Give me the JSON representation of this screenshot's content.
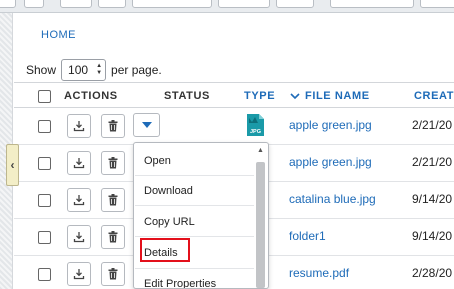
{
  "breadcrumb": "HOME",
  "pagination": {
    "show_label": "Show",
    "per_page_value": "100",
    "per_page_suffix": "per page."
  },
  "table": {
    "headers": {
      "actions": "ACTIONS",
      "status": "STATUS",
      "type": "TYPE",
      "file_name": "FILE NAME",
      "created": "CREATE"
    },
    "sorted_column": "file_name",
    "rows": [
      {
        "name": "apple green.jpg",
        "created": "2/21/20",
        "type": "JPG"
      },
      {
        "name": "apple green.jpg",
        "created": "2/21/20"
      },
      {
        "name": "catalina blue.jpg",
        "created": "9/14/20"
      },
      {
        "name": "folder1",
        "created": "9/14/20"
      },
      {
        "name": "resume.pdf",
        "created": "2/28/20"
      }
    ]
  },
  "menu": {
    "items": [
      "Open",
      "Download",
      "Copy URL",
      "Details",
      "Edit Properties"
    ],
    "highlighted": "Details"
  },
  "colors": {
    "link": "#1e6bb8",
    "highlight": "#e3101b",
    "file_icon": "#1a9aa8"
  }
}
